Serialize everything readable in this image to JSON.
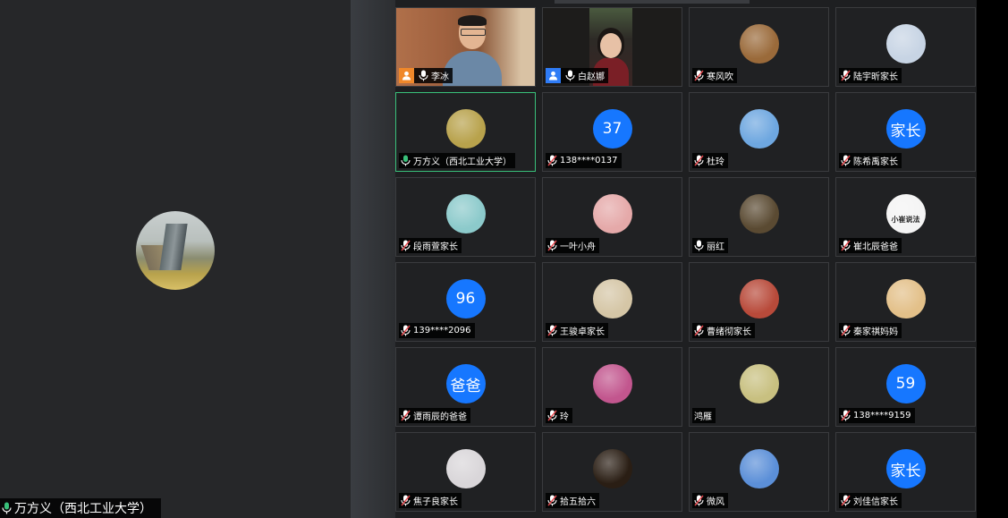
{
  "speaker": {
    "name": "万方义（西北工业大学）"
  },
  "colors": {
    "accent_blue": "#1677ff",
    "active_border": "#39c07a",
    "mic_active": "#39c07a",
    "host_badge": "#f0882a",
    "cohost_badge": "#2f7cf6"
  },
  "participants": [
    {
      "name": "李冰",
      "mic": "on",
      "badge": "host",
      "video": "video1"
    },
    {
      "name": "白赵娜",
      "mic": "on",
      "badge": "cohost",
      "video": "video2"
    },
    {
      "name": "寒风吹",
      "mic": "muted",
      "avatar_icon": "ornament-photo-icon",
      "avatar_color": "#9a6a3a"
    },
    {
      "name": "陆宇昕家长",
      "mic": "muted",
      "avatar_icon": "kids-photo-icon",
      "avatar_color": "#c7d4e4"
    },
    {
      "name": "万方义（西北工业大学）",
      "mic": "active",
      "active": true,
      "avatar_icon": "building-photo-icon",
      "avatar_color": "#b8a24c"
    },
    {
      "name": "138****0137",
      "mic": "muted",
      "avatar_text": "37"
    },
    {
      "name": "杜玲",
      "mic": "muted",
      "avatar_icon": "lake-photo-icon",
      "avatar_color": "#6ea7e0"
    },
    {
      "name": "陈希禹家长",
      "mic": "muted",
      "avatar_text": "家长"
    },
    {
      "name": "段雨萱家长",
      "mic": "muted",
      "avatar_icon": "teal-circle-icon",
      "avatar_color": "#8ccacb"
    },
    {
      "name": "一叶小舟",
      "mic": "muted",
      "avatar_icon": "couple-photo-icon",
      "avatar_color": "#e5a9a9"
    },
    {
      "name": "丽红",
      "mic": "on",
      "avatar_icon": "child-photo-icon",
      "avatar_color": "#5a4a32"
    },
    {
      "name": "崔北辰爸爸",
      "mic": "muted",
      "avatar_icon": "logo-photo-icon",
      "avatar_color": "#f4f4f4",
      "avatar_logo_text": "小崔说法"
    },
    {
      "name": "139****2096",
      "mic": "muted",
      "avatar_text": "96"
    },
    {
      "name": "王骏卓家长",
      "mic": "muted",
      "avatar_icon": "baby-photo-icon",
      "avatar_color": "#d5c6a6"
    },
    {
      "name": "曹绪彻家长",
      "mic": "muted",
      "avatar_icon": "gate-photo-icon",
      "avatar_color": "#b84a3a"
    },
    {
      "name": "秦家祺妈妈",
      "mic": "muted",
      "avatar_icon": "sunset-photo-icon",
      "avatar_color": "#e3c089"
    },
    {
      "name": "谭雨辰的爸爸",
      "mic": "muted",
      "avatar_text": "爸爸"
    },
    {
      "name": "玲",
      "mic": "muted",
      "avatar_icon": "flower-photo-icon",
      "avatar_color": "#c2568e"
    },
    {
      "name": "鸿雁",
      "mic": "none",
      "avatar_icon": "vase-photo-icon",
      "avatar_color": "#c8c080"
    },
    {
      "name": "138****9159",
      "mic": "muted",
      "avatar_text": "59"
    },
    {
      "name": "焦子良家长",
      "mic": "muted",
      "avatar_icon": "cat-photo-icon",
      "avatar_color": "#d9d6d9"
    },
    {
      "name": "拾五拾六",
      "mic": "muted",
      "avatar_icon": "dark-photo-icon",
      "avatar_color": "#2a1e14"
    },
    {
      "name": "微风",
      "mic": "muted",
      "avatar_icon": "birds-photo-icon",
      "avatar_color": "#5b8fd8"
    },
    {
      "name": "刘佳信家长",
      "mic": "muted",
      "avatar_text": "家长"
    }
  ]
}
